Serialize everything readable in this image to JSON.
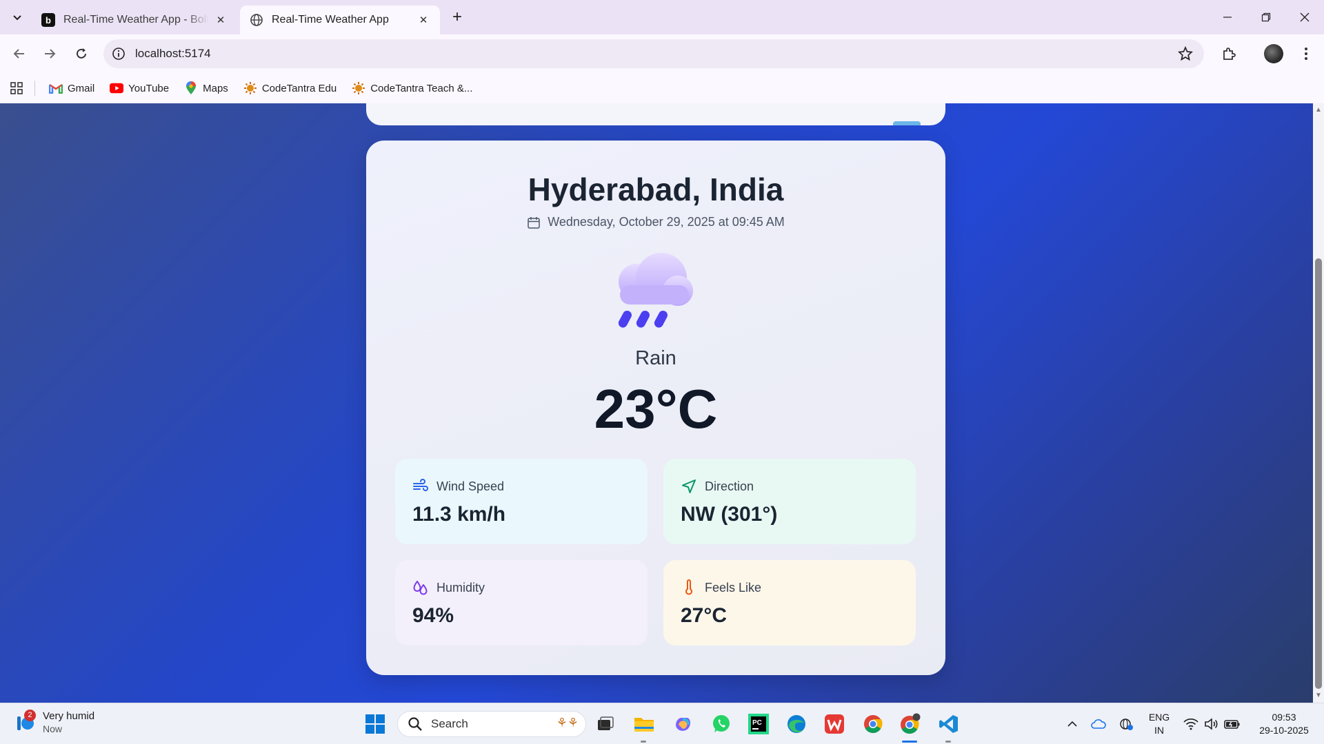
{
  "browser": {
    "tabs": [
      {
        "title": "Real-Time Weather App - Bolt.new",
        "active": false
      },
      {
        "title": "Real-Time Weather App",
        "active": true
      }
    ],
    "url": "localhost:5174",
    "bookmarks": [
      {
        "label": "Gmail",
        "icon": "gmail-icon"
      },
      {
        "label": "YouTube",
        "icon": "youtube-icon"
      },
      {
        "label": "Maps",
        "icon": "maps-icon"
      },
      {
        "label": "CodeTantra Edu",
        "icon": "codetantra-icon"
      },
      {
        "label": "CodeTantra Teach &...",
        "icon": "codetantra-icon"
      }
    ]
  },
  "weather": {
    "city": "Hyderabad, India",
    "datetime": "Wednesday, October 29, 2025 at 09:45 AM",
    "condition": "Rain",
    "temperature": "23°C",
    "stats": {
      "wind": {
        "label": "Wind Speed",
        "value": "11.3 km/h"
      },
      "direction": {
        "label": "Direction",
        "value": "NW (301°)"
      },
      "humidity": {
        "label": "Humidity",
        "value": "94%"
      },
      "feels_like": {
        "label": "Feels Like",
        "value": "27°C"
      }
    }
  },
  "taskbar": {
    "weather_widget": {
      "title": "Very humid",
      "subtitle": "Now",
      "badge": "2"
    },
    "search_placeholder": "Search",
    "language": {
      "line1": "ENG",
      "line2": "IN"
    },
    "clock": {
      "time": "09:53",
      "date": "29-10-2025"
    }
  },
  "colors": {
    "page_gradient_start": "#3a4f8e",
    "page_gradient_mid": "#2446c8",
    "card_bg": "#eef0fb",
    "wind_accent": "#2563eb",
    "direction_accent": "#059669",
    "humidity_accent": "#7c3aed",
    "feels_like_accent": "#ea580c"
  }
}
